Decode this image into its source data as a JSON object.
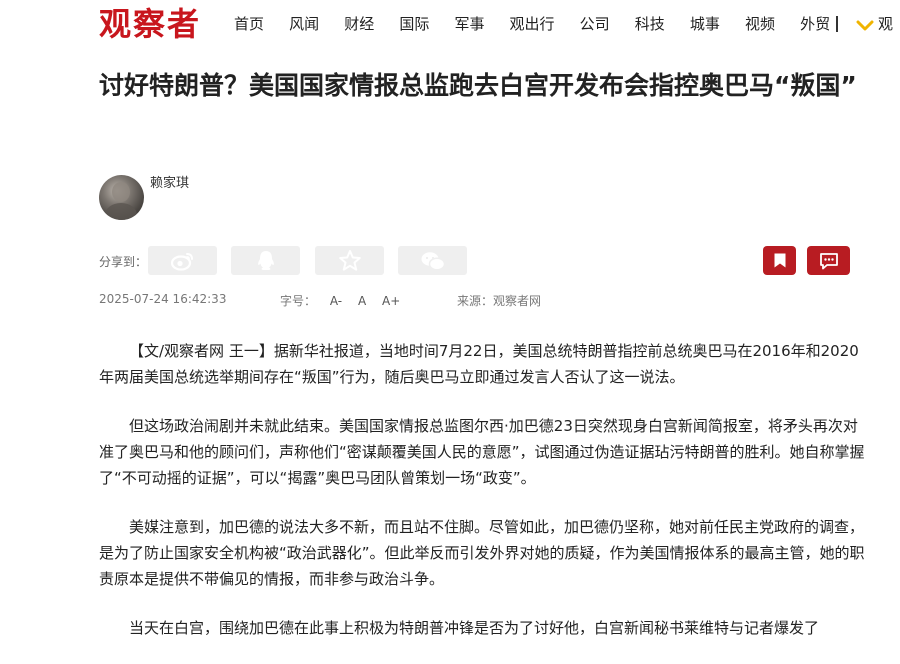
{
  "site": {
    "logo": "观察者"
  },
  "nav": {
    "items": [
      "首页",
      "风闻",
      "财经",
      "国际",
      "军事",
      "观出行",
      "公司",
      "科技",
      "城事",
      "视频",
      "外贸"
    ],
    "divider": "|",
    "more_label": "观"
  },
  "article": {
    "title": "讨好特朗普？美国国家情报总监跑去白宫开发布会指控奥巴马“叛国”",
    "author": "赖家琪",
    "share_label": "分享到：",
    "share_icons": [
      "weibo-icon",
      "qq-icon",
      "qzone-icon",
      "wechat-icon"
    ],
    "datetime": "2025-07-24 16:42:33",
    "font_size_label": "字号：",
    "font_controls": [
      "A-",
      "A",
      "A+"
    ],
    "source": "来源：观察者网",
    "paragraphs": [
      "【文/观察者网 王一】据新华社报道，当地时间7月22日，美国总统特朗普指控前总统奥巴马在2016年和2020年两届美国总统选举期间存在“叛国”行为，随后奥巴马立即通过发言人否认了这一说法。",
      "但这场政治闹剧并未就此结束。美国国家情报总监图尔西·加巴德23日突然现身白宫新闻简报室，将矛头再次对准了奥巴马和他的顾问们，声称他们“密谋颠覆美国人民的意愿”，试图通过伪造证据玷污特朗普的胜利。她自称掌握了“不可动摇的证据”，可以“揭露”奥巴马团队曾策划一场“政变”。",
      "美媒注意到，加巴德的说法大多不新，而且站不住脚。尽管如此，加巴德仍坚称，她对前任民主党政府的调查，是为了防止国家安全机构被“政治武器化”。但此举反而引发外界对她的质疑，作为美国情报体系的最高主管，她的职责原本是提供不带偏见的情报，而非参与政治斗争。",
      "当天在白宫，围绕加巴德在此事上积极为特朗普冲锋是否为了讨好他，白宫新闻秘书莱维特与记者爆发了"
    ]
  },
  "colors": {
    "brand": "#c8161d",
    "action_red": "#b81c22",
    "share_bg": "#efefef",
    "chevron": "#f0b400"
  }
}
